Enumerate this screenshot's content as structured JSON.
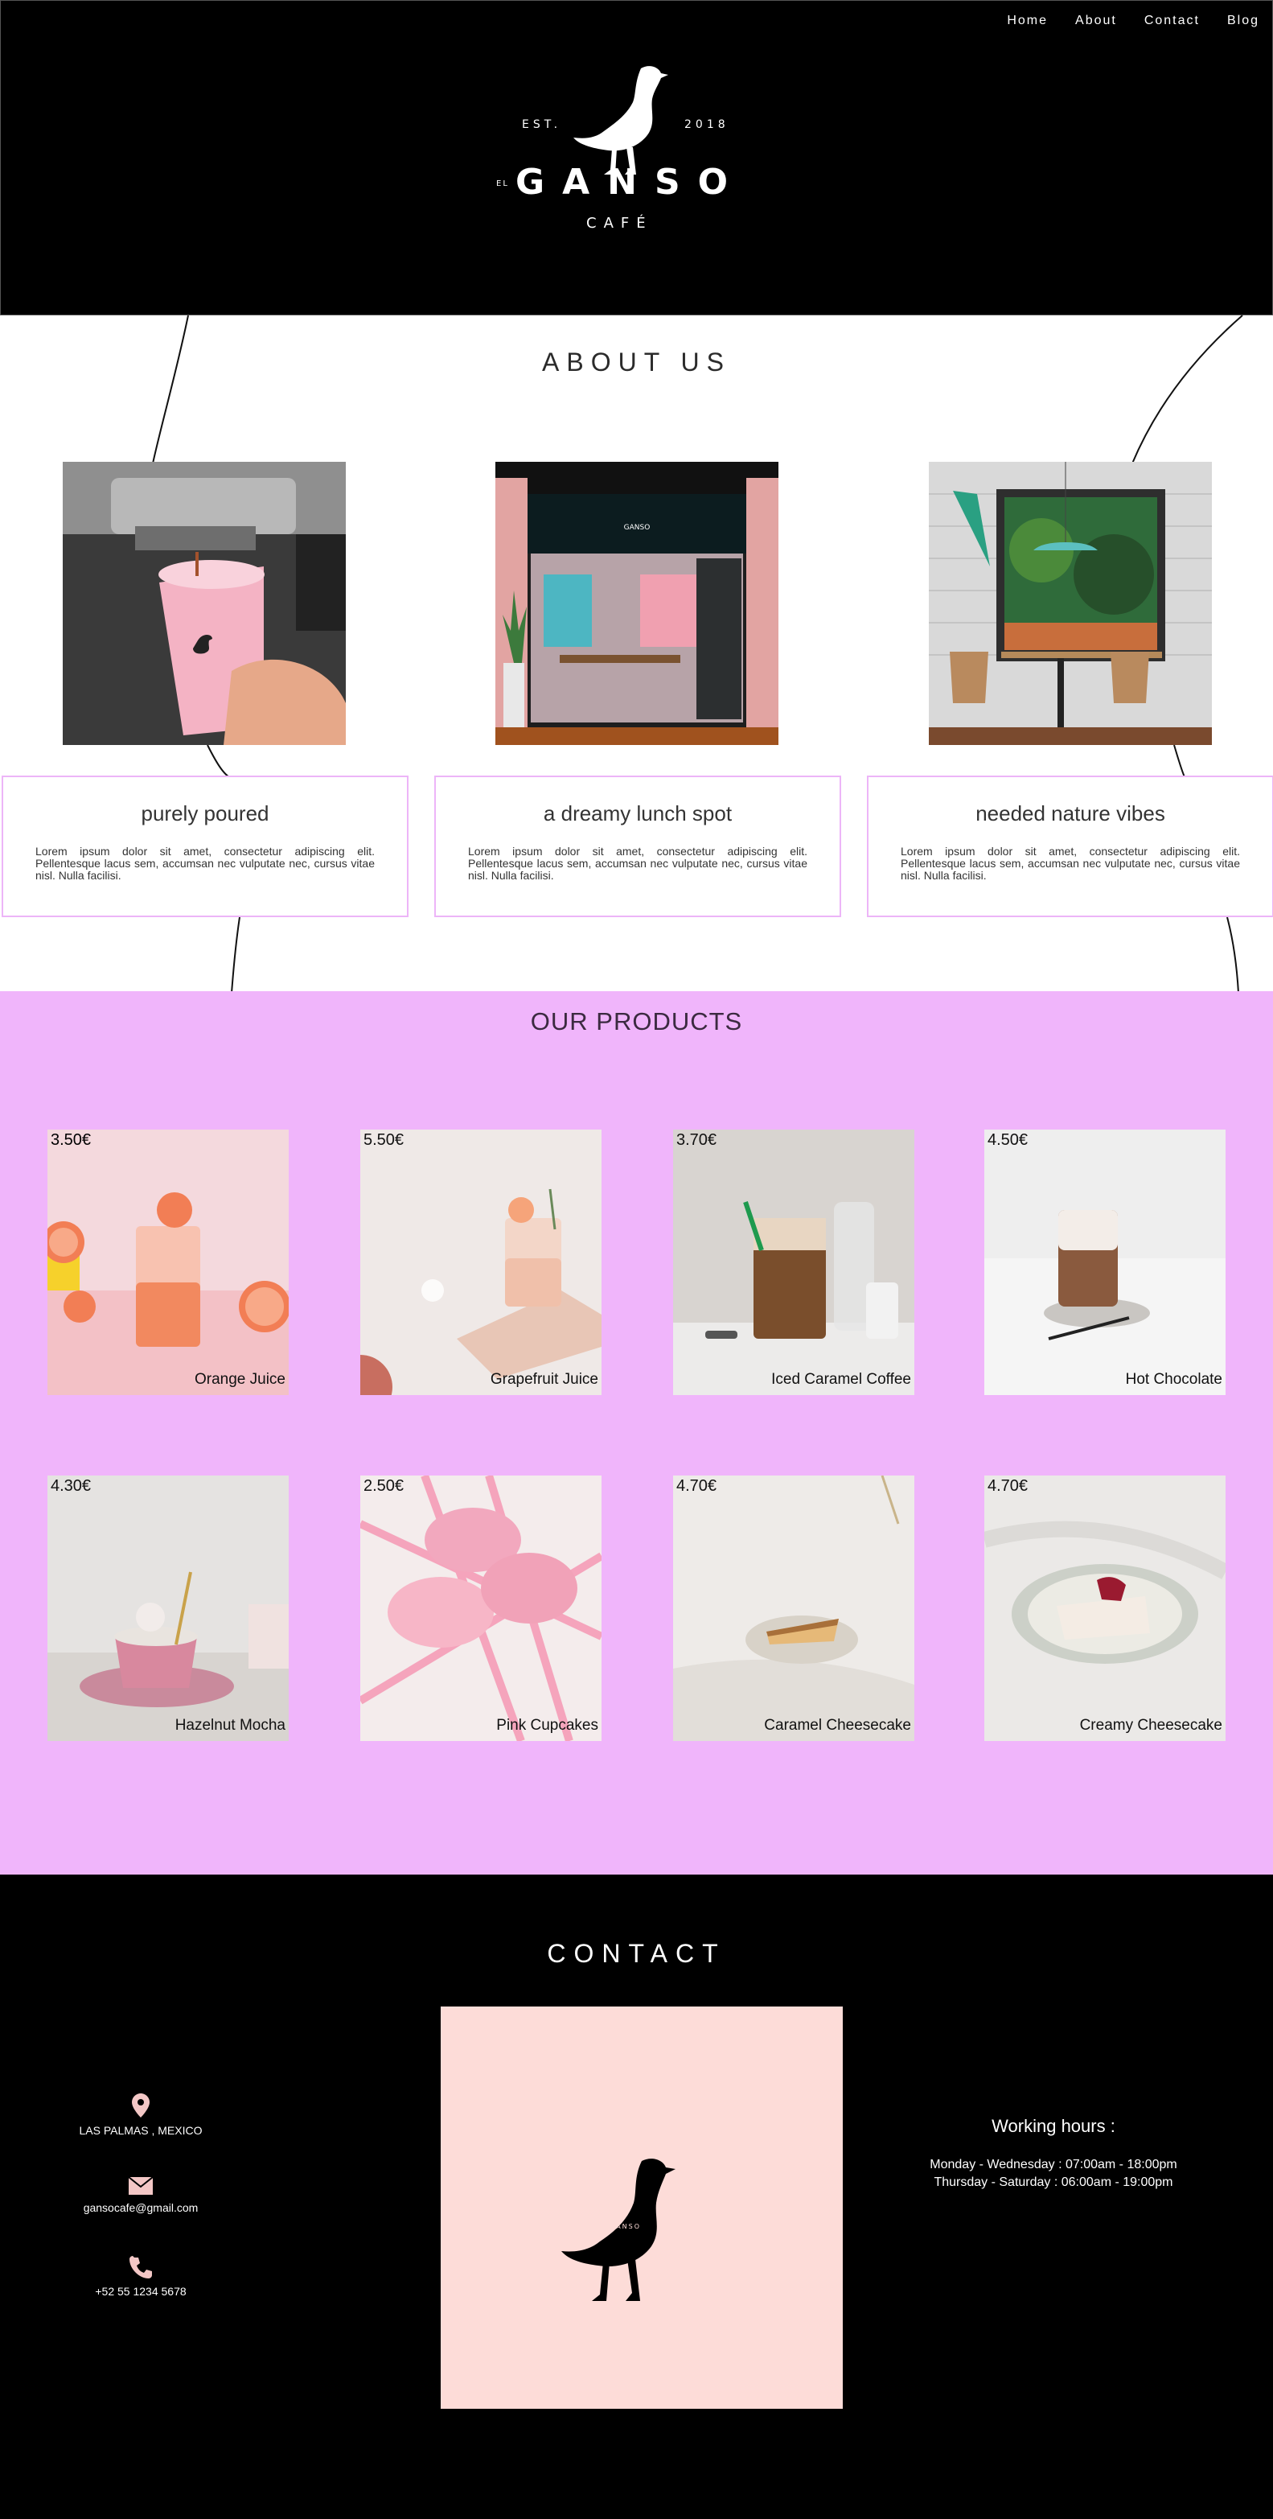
{
  "nav": {
    "items": [
      "Home",
      "About",
      "Contact",
      "Blog"
    ]
  },
  "logo": {
    "est": "EST.",
    "year": "2018",
    "el": "EL",
    "word": "GANSO",
    "sub": "CAFÉ"
  },
  "about": {
    "title": "ABOUT US",
    "cards": [
      {
        "title": "purely poured",
        "text": "Lorem ipsum dolor sit amet, consectetur adipiscing elit. Pellentesque lacus sem, accumsan nec vulputate nec, cursus vitae nisl. Nulla facilisi."
      },
      {
        "title": "a dreamy lunch spot",
        "text": "Lorem ipsum dolor sit amet, consectetur adipiscing elit. Pellentesque lacus sem, accumsan nec vulputate nec, cursus vitae nisl. Nulla facilisi."
      },
      {
        "title": "needed nature vibes",
        "text": "Lorem ipsum dolor sit amet, consectetur adipiscing elit. Pellentesque lacus sem, accumsan nec vulputate nec, cursus vitae nisl. Nulla facilisi."
      }
    ]
  },
  "products": {
    "title": "OUR PRODUCTS",
    "items": [
      {
        "price": "3.50€",
        "name": "Orange Juice"
      },
      {
        "price": "5.50€",
        "name": "Grapefruit Juice"
      },
      {
        "price": "3.70€",
        "name": "Iced Caramel Coffee"
      },
      {
        "price": "4.50€",
        "name": "Hot Chocolate"
      },
      {
        "price": "4.30€",
        "name": "Hazelnut Mocha"
      },
      {
        "price": "2.50€",
        "name": "Pink Cupcakes"
      },
      {
        "price": "4.70€",
        "name": "Caramel Cheesecake"
      },
      {
        "price": "4.70€",
        "name": "Creamy Cheesecake"
      }
    ]
  },
  "contact": {
    "title": "CONTACT",
    "location": "LAS PALMAS , MEXICO",
    "email": "gansocafe@gmail.com",
    "phone": "+52 55 1234 5678",
    "hours_title": "Working hours :",
    "hours_1": "Monday - Wednesday : 07:00am - 18:00pm",
    "hours_2": "Thursday - Saturday : 06:00am - 19:00pm",
    "map_logo": "GANSO"
  },
  "colors": {
    "pink": "#f0b5fb",
    "card_border": "#edb5f8",
    "map_bg": "#fddcd8"
  }
}
